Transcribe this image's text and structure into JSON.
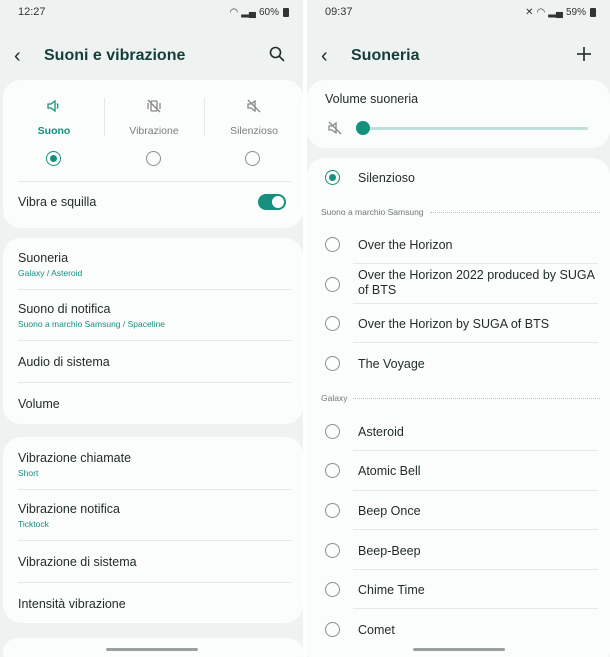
{
  "left": {
    "status": {
      "time": "12:27",
      "battery": "60%"
    },
    "title": "Suoni e vibrazione",
    "modes": [
      {
        "label": "Suono",
        "icon": "sound-icon",
        "selected": true
      },
      {
        "label": "Vibrazione",
        "icon": "vibrate-icon",
        "selected": false
      },
      {
        "label": "Silenzioso",
        "icon": "mute-icon",
        "selected": false
      }
    ],
    "vibra_e_squilla": {
      "label": "Vibra e squilla",
      "on": true
    },
    "group1": [
      {
        "title": "Suoneria",
        "sub": "Galaxy / Asteroid"
      },
      {
        "title": "Suono di notifica",
        "sub": "Suono a marchio Samsung / Spaceline"
      },
      {
        "title": "Audio di sistema",
        "sub": ""
      },
      {
        "title": "Volume",
        "sub": ""
      }
    ],
    "group2": [
      {
        "title": "Vibrazione chiamate",
        "sub": "Short"
      },
      {
        "title": "Vibrazione notifica",
        "sub": "Ticktock"
      },
      {
        "title": "Vibrazione di sistema",
        "sub": ""
      },
      {
        "title": "Intensità vibrazione",
        "sub": ""
      }
    ]
  },
  "right": {
    "status": {
      "time": "09:37",
      "battery": "59%"
    },
    "title": "Suoneria",
    "volume_label": "Volume suoneria",
    "volume_level": 0,
    "silent_option": "Silenzioso",
    "section_samsung": "Suono a marchio Samsung",
    "samsung_tones": [
      "Over the Horizon",
      "Over the Horizon 2022 produced by SUGA of BTS",
      "Over the Horizon by SUGA of BTS",
      "The Voyage"
    ],
    "section_galaxy": "Galaxy",
    "galaxy_tones": [
      "Asteroid",
      "Atomic Bell",
      "Beep Once",
      "Beep-Beep",
      "Chime Time",
      "Comet"
    ],
    "accent_color": "#14907d"
  }
}
